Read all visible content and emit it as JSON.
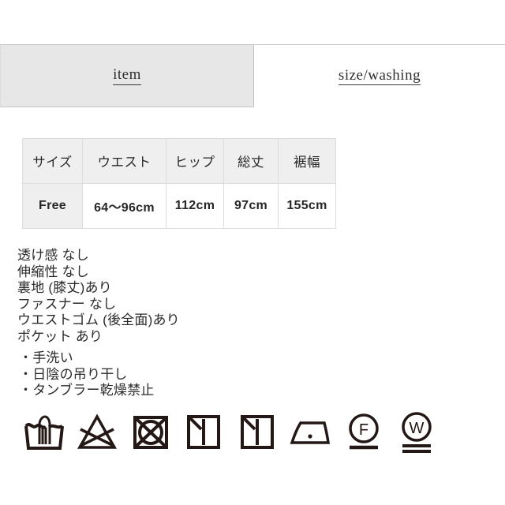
{
  "tabs": [
    {
      "label": "item",
      "name": "tab-item",
      "selected": true
    },
    {
      "label": "size/washing",
      "name": "tab-size-washing",
      "selected": false
    }
  ],
  "size_table": {
    "headers": [
      "サイズ",
      "ウエスト",
      "ヒップ",
      "総丈",
      "裾幅"
    ],
    "rows": [
      [
        "Free",
        "64〜96cm",
        "112cm",
        "97cm",
        "155cm"
      ]
    ]
  },
  "attributes": [
    "透け感 なし",
    "伸縮性 なし",
    "裏地 (膝丈)あり",
    "ファスナー なし",
    "ウエストゴム (後全面)あり",
    "ポケット あり"
  ],
  "care_instructions": [
    "・手洗い",
    "・日陰の吊り干し",
    "・タンブラー乾燥禁止"
  ],
  "care_symbols": [
    {
      "name": "hand-wash-icon",
      "title": "手洗い"
    },
    {
      "name": "do-not-bleach-icon",
      "title": "塩素・酸素系漂白剤使用禁止"
    },
    {
      "name": "do-not-tumble-dry-icon",
      "title": "タンブラー乾燥禁止"
    },
    {
      "name": "drip-dry-in-shade-icon",
      "title": "日陰のつり干し"
    },
    {
      "name": "line-dry-in-shade-icon",
      "title": "日陰のつり干し"
    },
    {
      "name": "iron-low-heat-icon",
      "title": "低温アイロン"
    },
    {
      "name": "dry-clean-petroleum-mild-icon",
      "title": "石油系ドライクリーニング弱"
    },
    {
      "name": "wet-clean-very-mild-icon",
      "title": "ウエットクリーニング非常に弱"
    }
  ],
  "colors": {
    "tab_active_bg": "#e7e7e7",
    "table_header_bg": "#efefef",
    "border": "#dcdcdc",
    "text": "#2b2b2b",
    "symbol_stroke": "#231815"
  }
}
